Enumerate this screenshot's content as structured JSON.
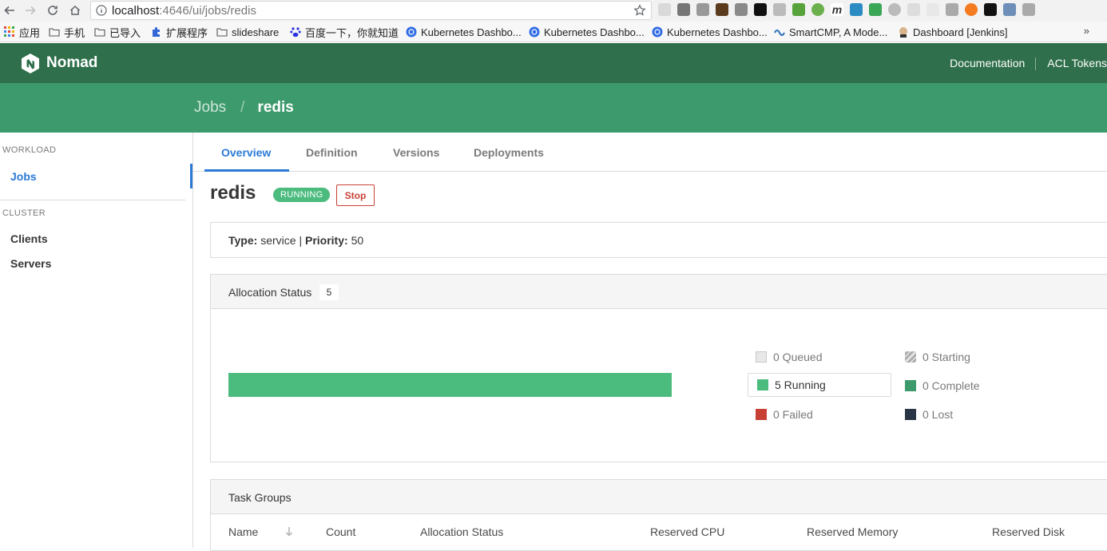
{
  "browser": {
    "url_host": "localhost",
    "url_rest": ":4646/ui/jobs/redis",
    "bookmarks": [
      {
        "label": "应用",
        "icon": "apps-grid-icon"
      },
      {
        "label": "手机",
        "icon": "folder-icon"
      },
      {
        "label": "已导入",
        "icon": "folder-icon"
      },
      {
        "label": "扩展程序",
        "icon": "puzzle-icon"
      },
      {
        "label": "slideshare",
        "icon": "folder-icon"
      },
      {
        "label": "百度一下，你就知道",
        "icon": "baidu-paw-icon"
      },
      {
        "label": "Kubernetes Dashbo...",
        "icon": "kubernetes-icon"
      },
      {
        "label": "Kubernetes Dashbo...",
        "icon": "kubernetes-icon"
      },
      {
        "label": "Kubernetes Dashbo...",
        "icon": "kubernetes-icon"
      },
      {
        "label": "SmartCMP, A Mode...",
        "icon": "smartcmp-icon"
      },
      {
        "label": "Dashboard [Jenkins]",
        "icon": "jenkins-icon"
      }
    ],
    "bookmarks_more": "»"
  },
  "header": {
    "brand": "Nomad",
    "links": {
      "documentation": "Documentation",
      "acl_tokens": "ACL Tokens"
    }
  },
  "breadcrumb": {
    "root": "Jobs",
    "separator": "/",
    "current": "redis"
  },
  "sidebar": {
    "sections": [
      {
        "label": "WORKLOAD",
        "items": [
          "Jobs"
        ]
      },
      {
        "label": "CLUSTER",
        "items": [
          "Clients",
          "Servers"
        ]
      }
    ],
    "active_item": "Jobs"
  },
  "tabs": [
    "Overview",
    "Definition",
    "Versions",
    "Deployments"
  ],
  "active_tab": "Overview",
  "job": {
    "name": "redis",
    "status": "RUNNING",
    "stop_label": "Stop",
    "type_label": "Type:",
    "type": "service",
    "divider": "|",
    "priority_label": "Priority:",
    "priority": "50"
  },
  "allocation_status": {
    "title": "Allocation Status",
    "total": "5",
    "running_fraction": 1.0,
    "legend": [
      {
        "label": "0 Queued",
        "color": "#e8e8e8",
        "active": false
      },
      {
        "label": "0 Starting",
        "color": "#bbbbbb",
        "active": false,
        "pattern": "striped"
      },
      {
        "label": "5 Running",
        "color": "#4cbb7e",
        "active": true
      },
      {
        "label": "0 Complete",
        "color": "#3d9a6c",
        "active": false
      },
      {
        "label": "0 Failed",
        "color": "#c84034",
        "active": false
      },
      {
        "label": "0 Lost",
        "color": "#2a3545",
        "active": false
      }
    ]
  },
  "task_groups": {
    "title": "Task Groups",
    "columns": [
      "Name",
      "Count",
      "Allocation Status",
      "Reserved CPU",
      "Reserved Memory",
      "Reserved Disk"
    ]
  },
  "colors": {
    "nomad_dark": "#2f6f4b",
    "nomad_green": "#3d9a6c",
    "link_blue": "#2b7ad6",
    "danger": "#c84034"
  }
}
